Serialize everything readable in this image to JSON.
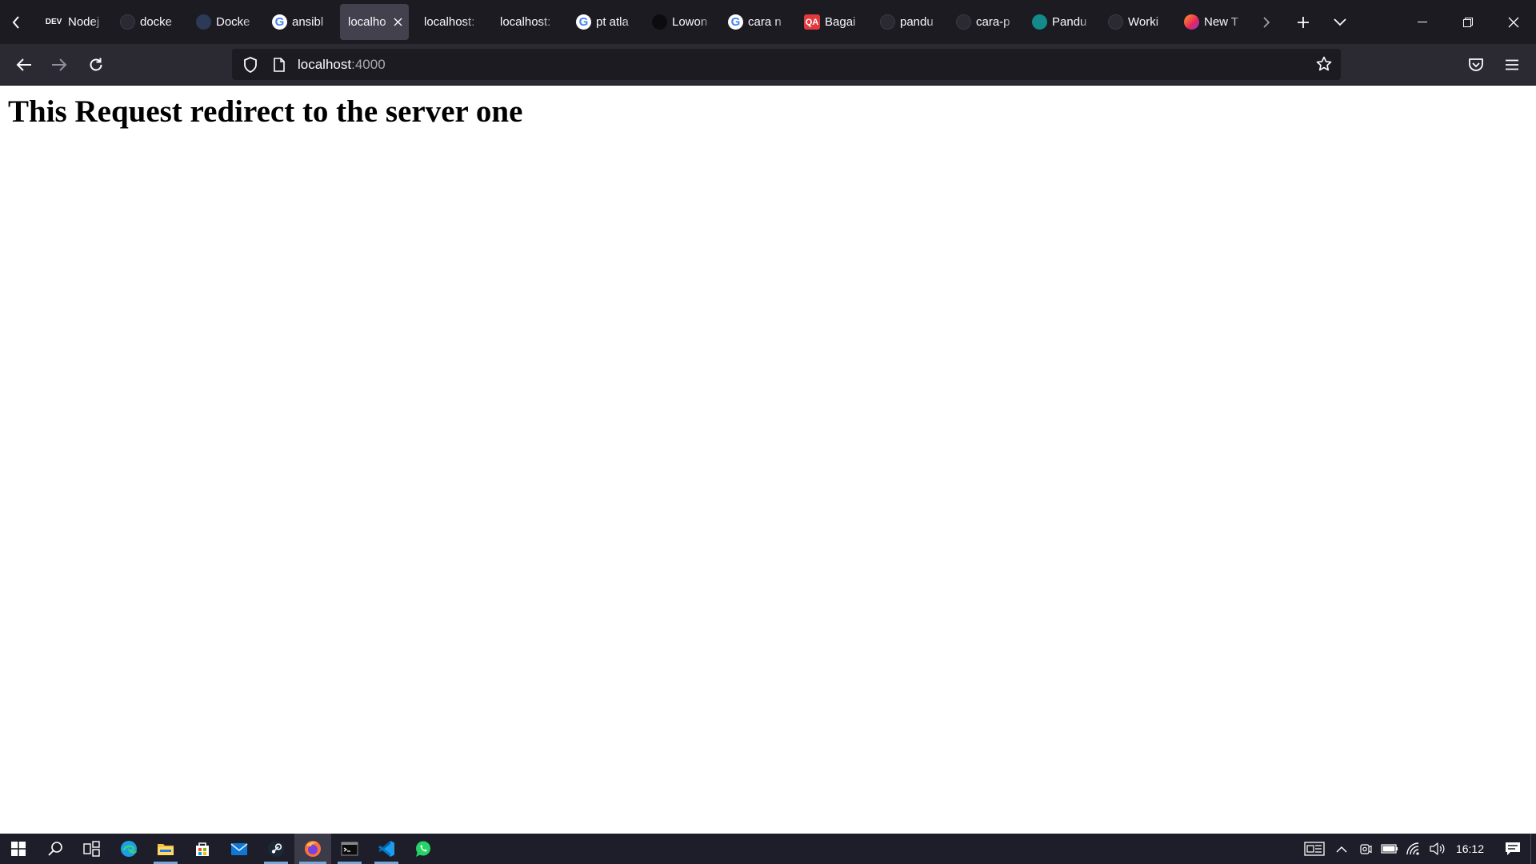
{
  "browser": {
    "tabs": [
      {
        "favicon": "dev-logo",
        "title": "Nodej",
        "active": false
      },
      {
        "favicon": "github-icon",
        "title": "docke",
        "active": false
      },
      {
        "favicon": "docker-icon",
        "title": "Docke",
        "active": false
      },
      {
        "favicon": "google-icon",
        "title": "ansibl",
        "active": false
      },
      {
        "favicon": "none",
        "title": "localho",
        "active": true
      },
      {
        "favicon": "none",
        "title": "localhost:",
        "active": false
      },
      {
        "favicon": "none",
        "title": "localhost:",
        "active": false
      },
      {
        "favicon": "google-icon",
        "title": "pt atla",
        "active": false
      },
      {
        "favicon": "lowongan-icon",
        "title": "Lowon",
        "active": false
      },
      {
        "favicon": "google-icon",
        "title": "cara n",
        "active": false
      },
      {
        "favicon": "qa-icon",
        "title": "Bagai",
        "active": false
      },
      {
        "favicon": "github-icon",
        "title": "pandu",
        "active": false
      },
      {
        "favicon": "github-icon",
        "title": "cara-p",
        "active": false
      },
      {
        "favicon": "pandu-icon",
        "title": "Pandu",
        "active": false
      },
      {
        "favicon": "github-icon",
        "title": "Worki",
        "active": false
      },
      {
        "favicon": "firefox-icon",
        "title": "New T",
        "active": false
      }
    ],
    "favicon_text": {
      "dev": "DEV",
      "qa": "QA",
      "google": "G"
    },
    "url": {
      "host": "localhost",
      "port": ":4000"
    }
  },
  "page": {
    "heading": "This Request redirect to the server one"
  },
  "taskbar": {
    "apps": [
      "start-icon",
      "search-icon",
      "task-view-icon",
      "edge-icon",
      "file-explorer-icon",
      "store-icon",
      "mail-icon",
      "steam-icon",
      "firefox-icon",
      "terminal-icon",
      "vscode-icon",
      "whatsapp-icon"
    ],
    "clock": "16:12"
  },
  "colors": {
    "tabstrip": "#1c1b22",
    "toolbar": "#2b2a33",
    "active_tab": "#42414d",
    "taskbar": "#1e1e2a"
  }
}
